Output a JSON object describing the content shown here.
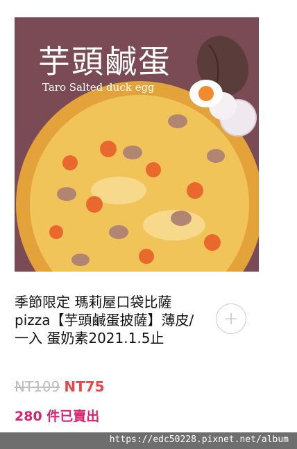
{
  "product": {
    "image": {
      "title": "芋頭鹹蛋",
      "subtitle": "Taro Salted duck egg"
    },
    "title": "季節限定 瑪莉屋口袋比薩pizza【芋頭鹹蛋披薩】薄皮/一入 蛋奶素2021.1.5止",
    "original_price": "NT109",
    "sale_price": "NT75",
    "sold": "280 件已賣出",
    "add_icon": "plus-icon"
  },
  "colors": {
    "image_bg": "#7a4a55",
    "sale_price": "#e5474e",
    "sold": "#d6246e",
    "original_price": "#bdbdbd"
  },
  "watermark": {
    "text": "https://edc50228.pixnet.net/album"
  }
}
